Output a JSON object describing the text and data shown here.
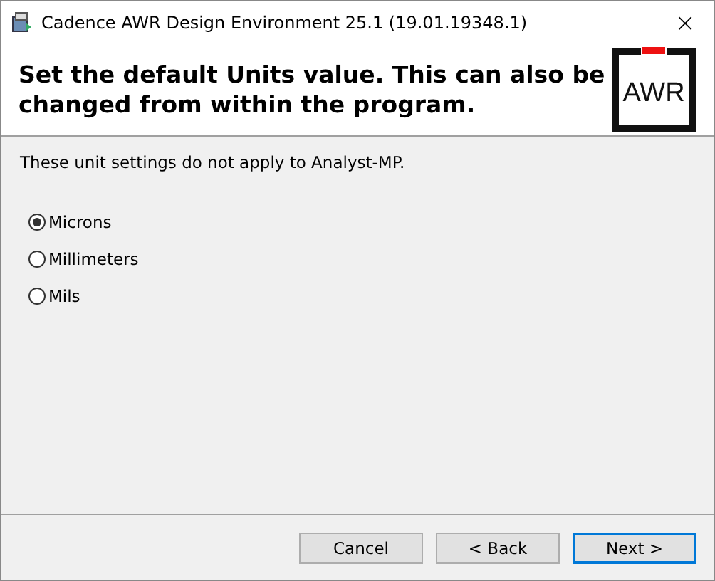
{
  "window": {
    "title": "Cadence AWR Design Environment 25.1 (19.01.19348.1)",
    "close": "×"
  },
  "header": {
    "heading": "Set the default Units value.  This can also be changed from within the program.",
    "logo": "AWR"
  },
  "note": "These unit settings do not apply to Analyst-MP.",
  "units": [
    {
      "label": "Microns",
      "selected": true
    },
    {
      "label": "Millimeters",
      "selected": false
    },
    {
      "label": "Mils",
      "selected": false
    }
  ],
  "buttons": [
    {
      "label": "Cancel",
      "focused": false
    },
    {
      "label": "< Back",
      "focused": false
    },
    {
      "label": "Next >",
      "focused": true
    }
  ]
}
